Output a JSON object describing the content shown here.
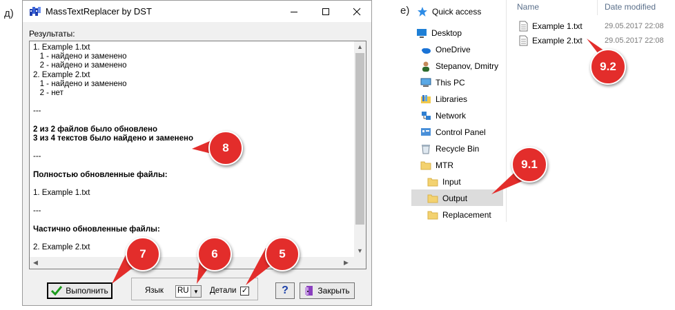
{
  "left": {
    "panel_letter": "д)",
    "window": {
      "title": "MassTextReplacer by DST",
      "results_label": "Результаты:",
      "results_lines": [
        {
          "text": "1. Example 1.txt",
          "bold": false
        },
        {
          "text": "   1 - найдено и заменено",
          "bold": false
        },
        {
          "text": "   2 - найдено и заменено",
          "bold": false
        },
        {
          "text": "2. Example 2.txt",
          "bold": false
        },
        {
          "text": "   1 - найдено и заменено",
          "bold": false
        },
        {
          "text": "   2 - нет",
          "bold": false
        },
        {
          "text": "",
          "bold": false
        },
        {
          "text": "---",
          "bold": false
        },
        {
          "text": "",
          "bold": false
        },
        {
          "text": "2 из 2 файлов было обновлено",
          "bold": true
        },
        {
          "text": "3 из 4 текстов было найдено и заменено",
          "bold": true
        },
        {
          "text": "",
          "bold": false
        },
        {
          "text": "---",
          "bold": false
        },
        {
          "text": "",
          "bold": false
        },
        {
          "text": "Полностью обновленные файлы:",
          "bold": true
        },
        {
          "text": "",
          "bold": false
        },
        {
          "text": "1. Example 1.txt",
          "bold": false
        },
        {
          "text": "",
          "bold": false
        },
        {
          "text": "---",
          "bold": false
        },
        {
          "text": "",
          "bold": false
        },
        {
          "text": "Частично обновленные файлы:",
          "bold": true
        },
        {
          "text": "",
          "bold": false
        },
        {
          "text": "2. Example 2.txt",
          "bold": false
        }
      ],
      "run_button": "Выполнить",
      "language_label": "Язык",
      "language_value": "RU",
      "details_label": "Детали",
      "details_checked": true,
      "help_button": "?",
      "close_button": "Закрыть"
    },
    "callouts": [
      "7",
      "6",
      "5",
      "8"
    ]
  },
  "right": {
    "panel_letter": "е)",
    "nav": [
      {
        "label": "Quick access",
        "icon": "star-icon"
      },
      {
        "label": "Desktop",
        "icon": "desktop-icon"
      },
      {
        "label": "OneDrive",
        "icon": "cloud-icon"
      },
      {
        "label": "Stepanov, Dmitry",
        "icon": "user-icon"
      },
      {
        "label": "This PC",
        "icon": "computer-icon"
      },
      {
        "label": "Libraries",
        "icon": "library-icon"
      },
      {
        "label": "Network",
        "icon": "network-icon"
      },
      {
        "label": "Control Panel",
        "icon": "control-panel-icon"
      },
      {
        "label": "Recycle Bin",
        "icon": "recycle-bin-icon"
      },
      {
        "label": "MTR",
        "icon": "folder-icon"
      },
      {
        "label": "Input",
        "icon": "folder-icon"
      },
      {
        "label": "Output",
        "icon": "folder-icon",
        "selected": true
      },
      {
        "label": "Replacement",
        "icon": "folder-icon"
      }
    ],
    "columns": {
      "name": "Name",
      "date": "Date modified"
    },
    "files": [
      {
        "name": "Example 1.txt",
        "date": "29.05.2017 22:08"
      },
      {
        "name": "Example 2.txt",
        "date": "29.05.2017 22:08"
      }
    ],
    "callouts": [
      "9.1",
      "9.2"
    ]
  },
  "colors": {
    "callout": "#e32d2b",
    "selection": "#dcdcdc"
  }
}
